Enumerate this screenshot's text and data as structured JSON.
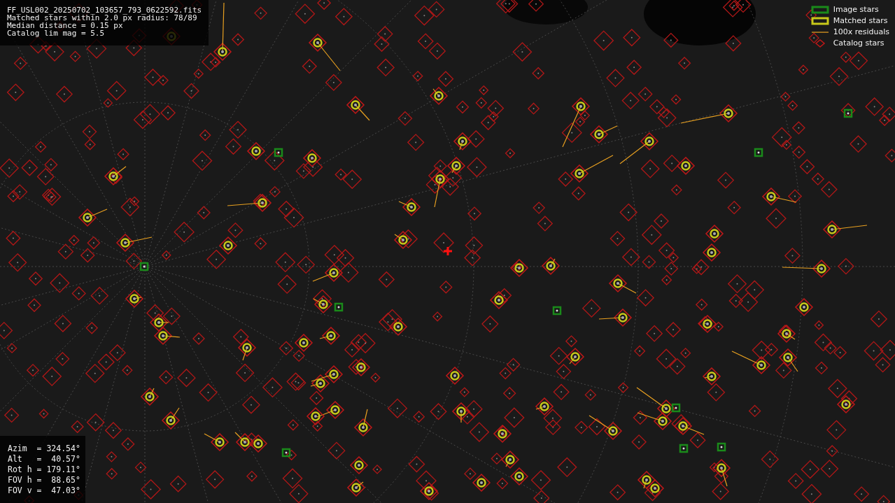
{
  "info": {
    "lines": [
      "FF_USL002_20250702_103657_793_0622592.fits",
      "Matched stars within 2.0 px radius: 78/89",
      "Median distance = 0.15 px",
      "Catalog lim mag = 5.5"
    ]
  },
  "legend": [
    {
      "kind": "image",
      "label": "Image stars"
    },
    {
      "kind": "matched",
      "label": "Matched stars"
    },
    {
      "kind": "residual",
      "label": "100x residuals"
    },
    {
      "kind": "catalog",
      "label": "Catalog stars"
    }
  ],
  "pose": {
    "lines": [
      "Azim  = 324.54°",
      "Alt   =  40.57°",
      "Rot h = 179.11°",
      "FOV h =  88.65°",
      "FOV v =  47.03°"
    ]
  }
}
